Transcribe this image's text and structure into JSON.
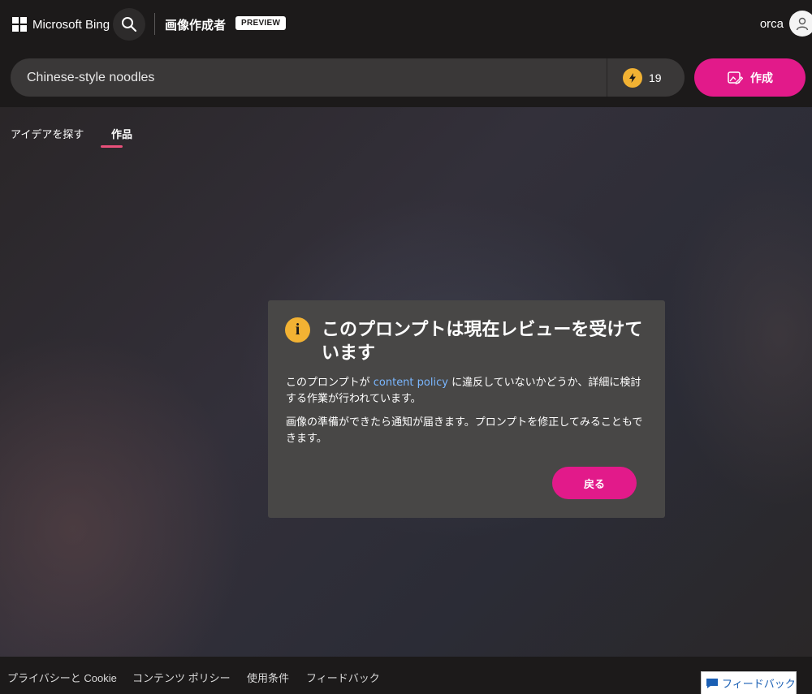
{
  "header": {
    "brand": "Microsoft Bing",
    "app_title": "画像作成者",
    "badge": "PREVIEW",
    "username": "orca"
  },
  "prompt": {
    "value": "Chinese-style noodles",
    "boosts": "19",
    "create_label": "作成"
  },
  "tabs": [
    {
      "label": "アイデアを探す",
      "active": false
    },
    {
      "label": "作品",
      "active": true
    }
  ],
  "dialog": {
    "title": "このプロンプトは現在レビューを受けています",
    "p1_before": "このプロンプトが ",
    "p1_link": "content policy",
    "p1_after": " に違反していないかどうか、詳細に検討する作業が行われています。",
    "p2": "画像の準備ができたら通知が届きます。プロンプトを修正してみることもできます。",
    "back_label": "戻る"
  },
  "footer": {
    "privacy": "プライバシーと Cookie",
    "content_policy": "コンテンツ ポリシー",
    "terms": "使用条件",
    "feedback": "フィードバック"
  },
  "feedback_button": {
    "label": "フィードバック"
  },
  "colors": {
    "accent": "#e21a8a",
    "boost": "#f2b233",
    "link": "#7ab7ff",
    "background": "#1c1a1a"
  },
  "icons": [
    "windows-logo-icon",
    "search-icon",
    "user-icon",
    "lightning-icon",
    "image-pen-icon",
    "info-icon",
    "chat-icon"
  ]
}
